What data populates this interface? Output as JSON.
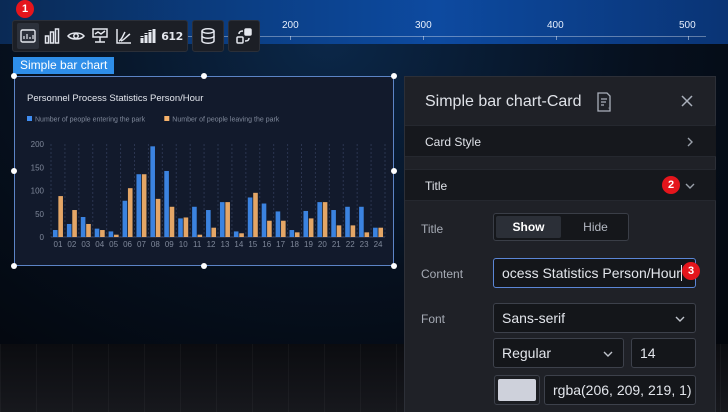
{
  "canvas": {
    "axis_ticks": [
      "200",
      "300",
      "400",
      "500"
    ]
  },
  "toolbar": {
    "tools": [
      "bar-chart-card-icon",
      "bar-chart-icon",
      "eye-target-icon",
      "line-chart-icon",
      "area-chart-icon",
      "stacked-bar-icon",
      "number-612-icon"
    ],
    "number_label": "612",
    "data_icon": "database-icon",
    "convert_icon": "convert-icon"
  },
  "badges": {
    "one": "1",
    "two": "2",
    "three": "3"
  },
  "component_label": "Simple bar chart",
  "panel": {
    "title": "Simple bar chart-Card",
    "sections": {
      "card_style": "Card Style",
      "title": "Title"
    },
    "fields": {
      "title_label": "Title",
      "show": "Show",
      "hide": "Hide",
      "content_label": "Content",
      "content_value": "ocess Statistics Person/Hour",
      "font_label": "Font",
      "font_value": "Sans-serif",
      "weight_value": "Regular",
      "size_value": "14",
      "color_value": "rgba(206, 209, 219, 1)"
    }
  },
  "chart_data": {
    "type": "bar",
    "title": "Personnel Process Statistics Person/Hour",
    "categories": [
      "01",
      "02",
      "03",
      "04",
      "05",
      "06",
      "07",
      "08",
      "09",
      "10",
      "11",
      "12",
      "13",
      "14",
      "15",
      "16",
      "17",
      "18",
      "19",
      "20",
      "21",
      "22",
      "23",
      "24"
    ],
    "series": [
      {
        "name": "Number of people entering the park",
        "color": "#3f8cf0",
        "values": [
          15,
          28,
          43,
          18,
          12,
          78,
          135,
          195,
          142,
          40,
          65,
          58,
          75,
          12,
          85,
          72,
          55,
          15,
          56,
          75,
          58,
          65,
          65,
          20
        ]
      },
      {
        "name": "Number of people leaving the park",
        "color": "#f6b26b",
        "values": [
          88,
          58,
          28,
          15,
          5,
          105,
          135,
          82,
          65,
          42,
          5,
          20,
          75,
          8,
          95,
          35,
          35,
          10,
          40,
          75,
          25,
          25,
          10,
          20
        ]
      }
    ],
    "ylim": [
      0,
      200
    ],
    "yticks": [
      "0",
      "50",
      "100",
      "150",
      "200"
    ],
    "legend": "top-left",
    "grid": true
  }
}
